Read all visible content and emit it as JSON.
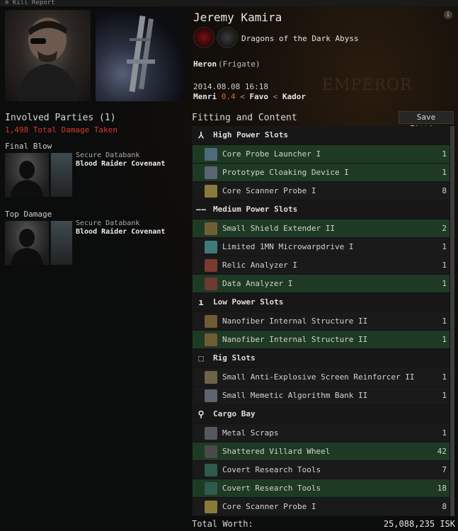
{
  "window": {
    "title": "Kill Report"
  },
  "header": {
    "pilot_name": "Jeremy Kamira",
    "corporation": "Dragons of the Dark Abyss",
    "ship_name": "Heron",
    "ship_class": "(Frigate)",
    "datetime": "2014.08.08 16:18",
    "location": {
      "system": "Menri",
      "security": "0.4",
      "sep1": "<",
      "constellation": "Favo",
      "sep2": "<",
      "region": "Kador"
    },
    "background_text": "EMPEROR"
  },
  "involved": {
    "title": "Involved Parties (1)",
    "damage_taken": "1,498 Total Damage Taken",
    "final_blow": {
      "label": "Final Blow",
      "ship": "Secure Databank",
      "corp": "Blood Raider Covenant"
    },
    "top_damage": {
      "label": "Top Damage",
      "ship": "Secure Databank",
      "corp": "Blood Raider Covenant"
    }
  },
  "fitting": {
    "title": "Fitting and Content",
    "save_button": "Save Fitting",
    "sections": {
      "high": {
        "label": "High Power Slots",
        "icon": "high-slot-icon",
        "items": [
          {
            "name": "Core Probe Launcher I",
            "qty": "1",
            "status": "fitted"
          },
          {
            "name": "Prototype Cloaking Device I",
            "qty": "1",
            "status": "fitted"
          },
          {
            "name": "Core Scanner Probe I",
            "qty": "8",
            "status": "destroyed"
          }
        ]
      },
      "medium": {
        "label": "Medium Power Slots",
        "icon": "medium-slot-icon",
        "items": [
          {
            "name": "Small Shield Extender II",
            "qty": "2",
            "status": "fitted"
          },
          {
            "name": "Limited 1MN Microwarpdrive I",
            "qty": "1",
            "status": "destroyed"
          },
          {
            "name": "Relic Analyzer I",
            "qty": "1",
            "status": "destroyed"
          },
          {
            "name": "Data Analyzer I",
            "qty": "1",
            "status": "fitted"
          }
        ]
      },
      "low": {
        "label": "Low Power Slots",
        "icon": "low-slot-icon",
        "items": [
          {
            "name": "Nanofiber Internal Structure II",
            "qty": "1",
            "status": "destroyed"
          },
          {
            "name": "Nanofiber Internal Structure II",
            "qty": "1",
            "status": "fitted"
          }
        ]
      },
      "rig": {
        "label": "Rig Slots",
        "icon": "rig-slot-icon",
        "items": [
          {
            "name": "Small Anti-Explosive Screen Reinforcer II",
            "qty": "1",
            "status": "destroyed"
          },
          {
            "name": "Small Memetic Algorithm Bank II",
            "qty": "1",
            "status": "destroyed"
          }
        ]
      },
      "cargo": {
        "label": "Cargo Bay",
        "icon": "cargo-bay-icon",
        "items": [
          {
            "name": "Metal Scraps",
            "qty": "1",
            "status": "destroyed"
          },
          {
            "name": "Shattered Villard Wheel",
            "qty": "42",
            "status": "fitted"
          },
          {
            "name": "Covert Research Tools",
            "qty": "7",
            "status": "destroyed"
          },
          {
            "name": "Covert Research Tools",
            "qty": "18",
            "status": "fitted"
          },
          {
            "name": "Core Scanner Probe I",
            "qty": "8",
            "status": "destroyed"
          }
        ]
      }
    },
    "total_label": "Total Worth:",
    "total_value": "25,088,235 ISK"
  },
  "colors": {
    "fitted_row": "#1f3a24",
    "destroyed_row": "#1a1a1a",
    "damage_red": "#d43a2c",
    "security_orange": "#e06a23"
  }
}
